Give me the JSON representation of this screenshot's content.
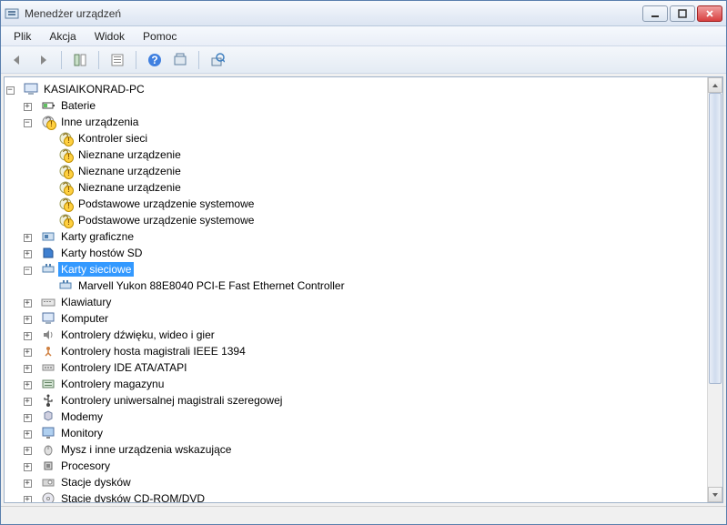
{
  "window": {
    "title": "Menedżer urządzeń"
  },
  "menu": {
    "file": "Plik",
    "action": "Akcja",
    "view": "Widok",
    "help": "Pomoc"
  },
  "tree": {
    "root": "KASIAIKONRAD-PC",
    "batteries": "Baterie",
    "other_devices": "Inne urządzenia",
    "other_items": {
      "net_ctrl": "Kontroler sieci",
      "unknown1": "Nieznane urządzenie",
      "unknown2": "Nieznane urządzenie",
      "unknown3": "Nieznane urządzenie",
      "base_sys1": "Podstawowe urządzenie systemowe",
      "base_sys2": "Podstawowe urządzenie systemowe"
    },
    "display": "Karty graficzne",
    "sd_host": "Karty hostów SD",
    "network": "Karty sieciowe",
    "network_item": "Marvell Yukon 88E8040 PCI-E Fast Ethernet Controller",
    "keyboards": "Klawiatury",
    "computer": "Komputer",
    "sound": "Kontrolery dźwięku, wideo i gier",
    "ieee1394": "Kontrolery hosta magistrali IEEE 1394",
    "ide": "Kontrolery IDE ATA/ATAPI",
    "storage": "Kontrolery magazynu",
    "usb": "Kontrolery uniwersalnej magistrali szeregowej",
    "modems": "Modemy",
    "monitors": "Monitory",
    "mice": "Mysz i inne urządzenia wskazujące",
    "processors": "Procesory",
    "disks": "Stacje dysków",
    "cdrom": "Stacje dysków CD-ROM/DVD"
  }
}
